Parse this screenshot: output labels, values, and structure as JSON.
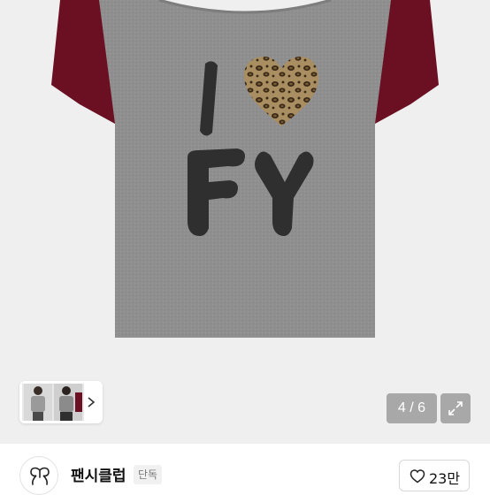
{
  "product": {
    "graphic_text": "I  FY",
    "colors": {
      "body": "#8f8f8f",
      "sleeves": "#6b1022",
      "print": "#2f2f2f",
      "background": "#efefef"
    }
  },
  "gallery": {
    "counter": "4 / 6",
    "expand_icon": "expand-icon",
    "thumbnail_arrow": "chevron-right-icon"
  },
  "shop": {
    "name": "팬시클럽",
    "badge": "단독",
    "logo_icon": "shop-logo-icon"
  },
  "like": {
    "icon": "heart-outline-icon",
    "count": "23만"
  }
}
